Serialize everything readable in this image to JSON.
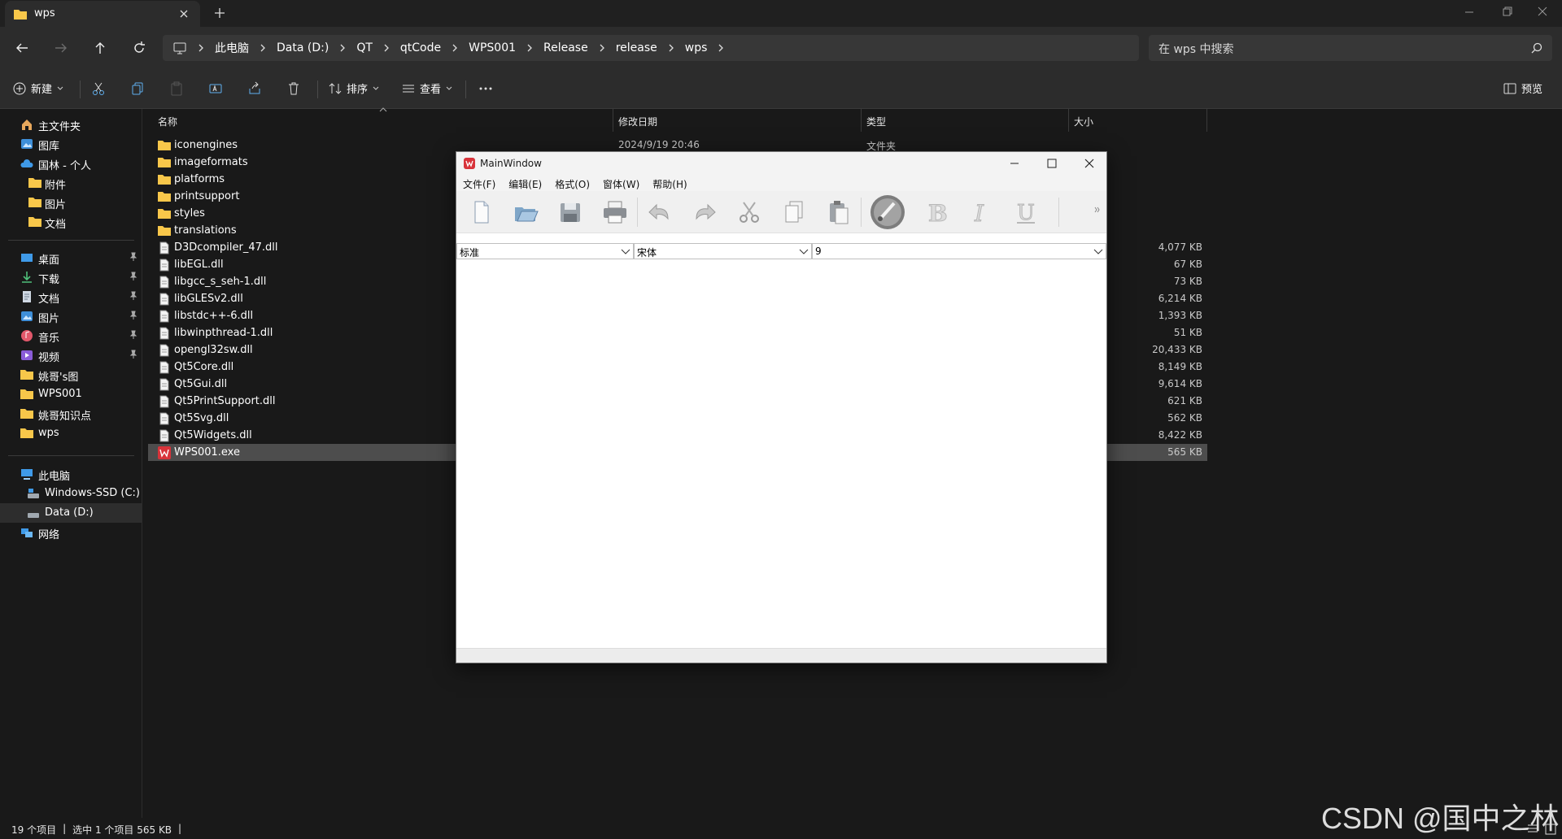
{
  "tab": {
    "title": "wps"
  },
  "address": {
    "crumbs": [
      "此电脑",
      "Data (D:)",
      "QT",
      "qtCode",
      "WPS001",
      "Release",
      "release",
      "wps"
    ],
    "search_placeholder": "在 wps 中搜索"
  },
  "commands": {
    "new_label": "新建",
    "sort_label": "排序",
    "view_label": "查看",
    "preview_label": "预览"
  },
  "sidebar": {
    "home": "主文件夹",
    "gallery": "图库",
    "onedrive": "国林 - 个人",
    "od_children": [
      "附件",
      "图片",
      "文档"
    ],
    "quick": [
      "桌面",
      "下载",
      "文档",
      "图片",
      "音乐",
      "视频",
      "姚哥's图",
      "WPS001",
      "姚哥知识点",
      "wps"
    ],
    "thispc": "此电脑",
    "drives": [
      "Windows-SSD (C:)",
      "Data (D:)"
    ],
    "network": "网络"
  },
  "columns": {
    "name": "名称",
    "date": "修改日期",
    "type": "类型",
    "size": "大小"
  },
  "files": [
    {
      "name": "iconengines",
      "date": "2024/9/19 20:46",
      "type": "文件夹",
      "size": "",
      "kind": "folder"
    },
    {
      "name": "imageformats",
      "date": "",
      "type": "",
      "size": "",
      "kind": "folder"
    },
    {
      "name": "platforms",
      "date": "",
      "type": "",
      "size": "",
      "kind": "folder"
    },
    {
      "name": "printsupport",
      "date": "",
      "type": "",
      "size": "",
      "kind": "folder"
    },
    {
      "name": "styles",
      "date": "",
      "type": "",
      "size": "",
      "kind": "folder"
    },
    {
      "name": "translations",
      "date": "",
      "type": "",
      "size": "",
      "kind": "folder"
    },
    {
      "name": "D3Dcompiler_47.dll",
      "date": "",
      "type": "",
      "size": "4,077 KB",
      "kind": "file"
    },
    {
      "name": "libEGL.dll",
      "date": "",
      "type": "",
      "size": "67 KB",
      "kind": "file"
    },
    {
      "name": "libgcc_s_seh-1.dll",
      "date": "",
      "type": "",
      "size": "73 KB",
      "kind": "file"
    },
    {
      "name": "libGLESv2.dll",
      "date": "",
      "type": "",
      "size": "6,214 KB",
      "kind": "file"
    },
    {
      "name": "libstdc++-6.dll",
      "date": "",
      "type": "",
      "size": "1,393 KB",
      "kind": "file"
    },
    {
      "name": "libwinpthread-1.dll",
      "date": "",
      "type": "",
      "size": "51 KB",
      "kind": "file"
    },
    {
      "name": "opengl32sw.dll",
      "date": "",
      "type": "",
      "size": "20,433 KB",
      "kind": "file"
    },
    {
      "name": "Qt5Core.dll",
      "date": "",
      "type": "",
      "size": "8,149 KB",
      "kind": "file"
    },
    {
      "name": "Qt5Gui.dll",
      "date": "",
      "type": "",
      "size": "9,614 KB",
      "kind": "file"
    },
    {
      "name": "Qt5PrintSupport.dll",
      "date": "",
      "type": "",
      "size": "621 KB",
      "kind": "file"
    },
    {
      "name": "Qt5Svg.dll",
      "date": "",
      "type": "",
      "size": "562 KB",
      "kind": "file"
    },
    {
      "name": "Qt5Widgets.dll",
      "date": "",
      "type": "",
      "size": "8,422 KB",
      "kind": "file"
    },
    {
      "name": "WPS001.exe",
      "date": "",
      "type": "",
      "size": "565 KB",
      "kind": "exe",
      "selected": true
    }
  ],
  "status": {
    "count": "19 个项目",
    "selected": "选中 1 个项目  565 KB"
  },
  "watermark": "CSDN @国中之林",
  "qt": {
    "title": "MainWindow",
    "menu": [
      "文件(F)",
      "编辑(E)",
      "格式(O)",
      "窗体(W)",
      "帮助(H)"
    ],
    "toolbar_icons": [
      "new-file-icon",
      "open-file-icon",
      "save-icon",
      "print-icon",
      "undo-icon",
      "redo-icon",
      "cut-icon",
      "copy-icon",
      "paste-icon",
      "color-icon",
      "bold-icon",
      "italic-icon",
      "underline-icon"
    ],
    "style_value": "标准",
    "font_value": "宋体",
    "size_value": "9"
  },
  "colors": {
    "accent": "#60cdff",
    "folder": "#f8c74a",
    "exe": "#d8333a",
    "selected_row": "#4d4d4d"
  }
}
